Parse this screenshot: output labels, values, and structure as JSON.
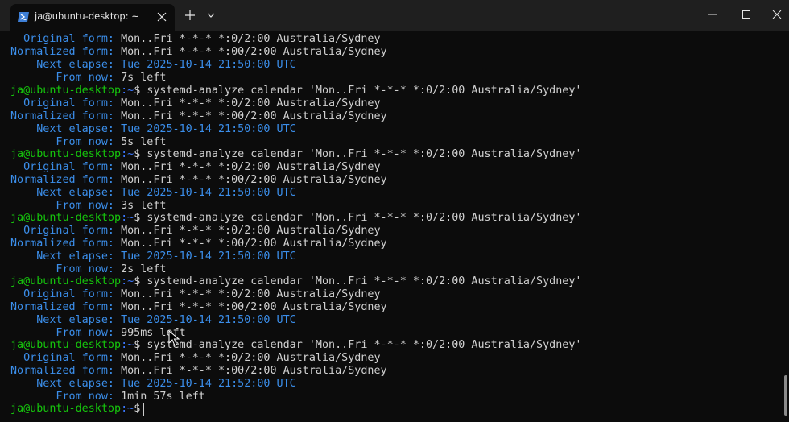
{
  "window": {
    "tab_title": "ja@ubuntu-desktop: ~",
    "icons": {
      "tab": "powershell-terminal-icon",
      "close_tab": "close-icon",
      "new_tab": "plus-icon",
      "dropdown": "chevron-down-icon",
      "minimize": "minimize-icon",
      "maximize": "maximize-icon",
      "close": "close-icon"
    }
  },
  "colors": {
    "background": "#0c0c0c",
    "titlebar": "#1f1f1f",
    "prompt_user": "#16c60c",
    "prompt_path": "#3b78ff",
    "label_blue": "#3b8eea",
    "text": "#d0d0d0"
  },
  "terminal": {
    "prompt_user": "ja@ubuntu-desktop",
    "prompt_path": ":~",
    "prompt_symbol": "$ ",
    "command": "systemd-analyze calendar 'Mon..Fri *-*-* *:0/2:00 Australia/Sydney'",
    "labels": {
      "original": "  Original form: ",
      "normalized": "Normalized form: ",
      "next": "    Next elapse: ",
      "from_now": "       From now: "
    },
    "original_form": "Mon..Fri *-*-* *:0/2:00 Australia/Sydney",
    "normalized_form": "Mon..Fri *-*-* *:00/2:00 Australia/Sydney",
    "blocks": [
      {
        "next_elapse": "Tue 2025-10-14 21:50:00 UTC",
        "from_now": "7s left"
      },
      {
        "next_elapse": "Tue 2025-10-14 21:50:00 UTC",
        "from_now": "5s left"
      },
      {
        "next_elapse": "Tue 2025-10-14 21:50:00 UTC",
        "from_now": "3s left"
      },
      {
        "next_elapse": "Tue 2025-10-14 21:50:00 UTC",
        "from_now": "2s left"
      },
      {
        "next_elapse": "Tue 2025-10-14 21:50:00 UTC",
        "from_now": "995ms left"
      },
      {
        "next_elapse": "Tue 2025-10-14 21:52:00 UTC",
        "from_now": "1min 57s left"
      }
    ]
  }
}
